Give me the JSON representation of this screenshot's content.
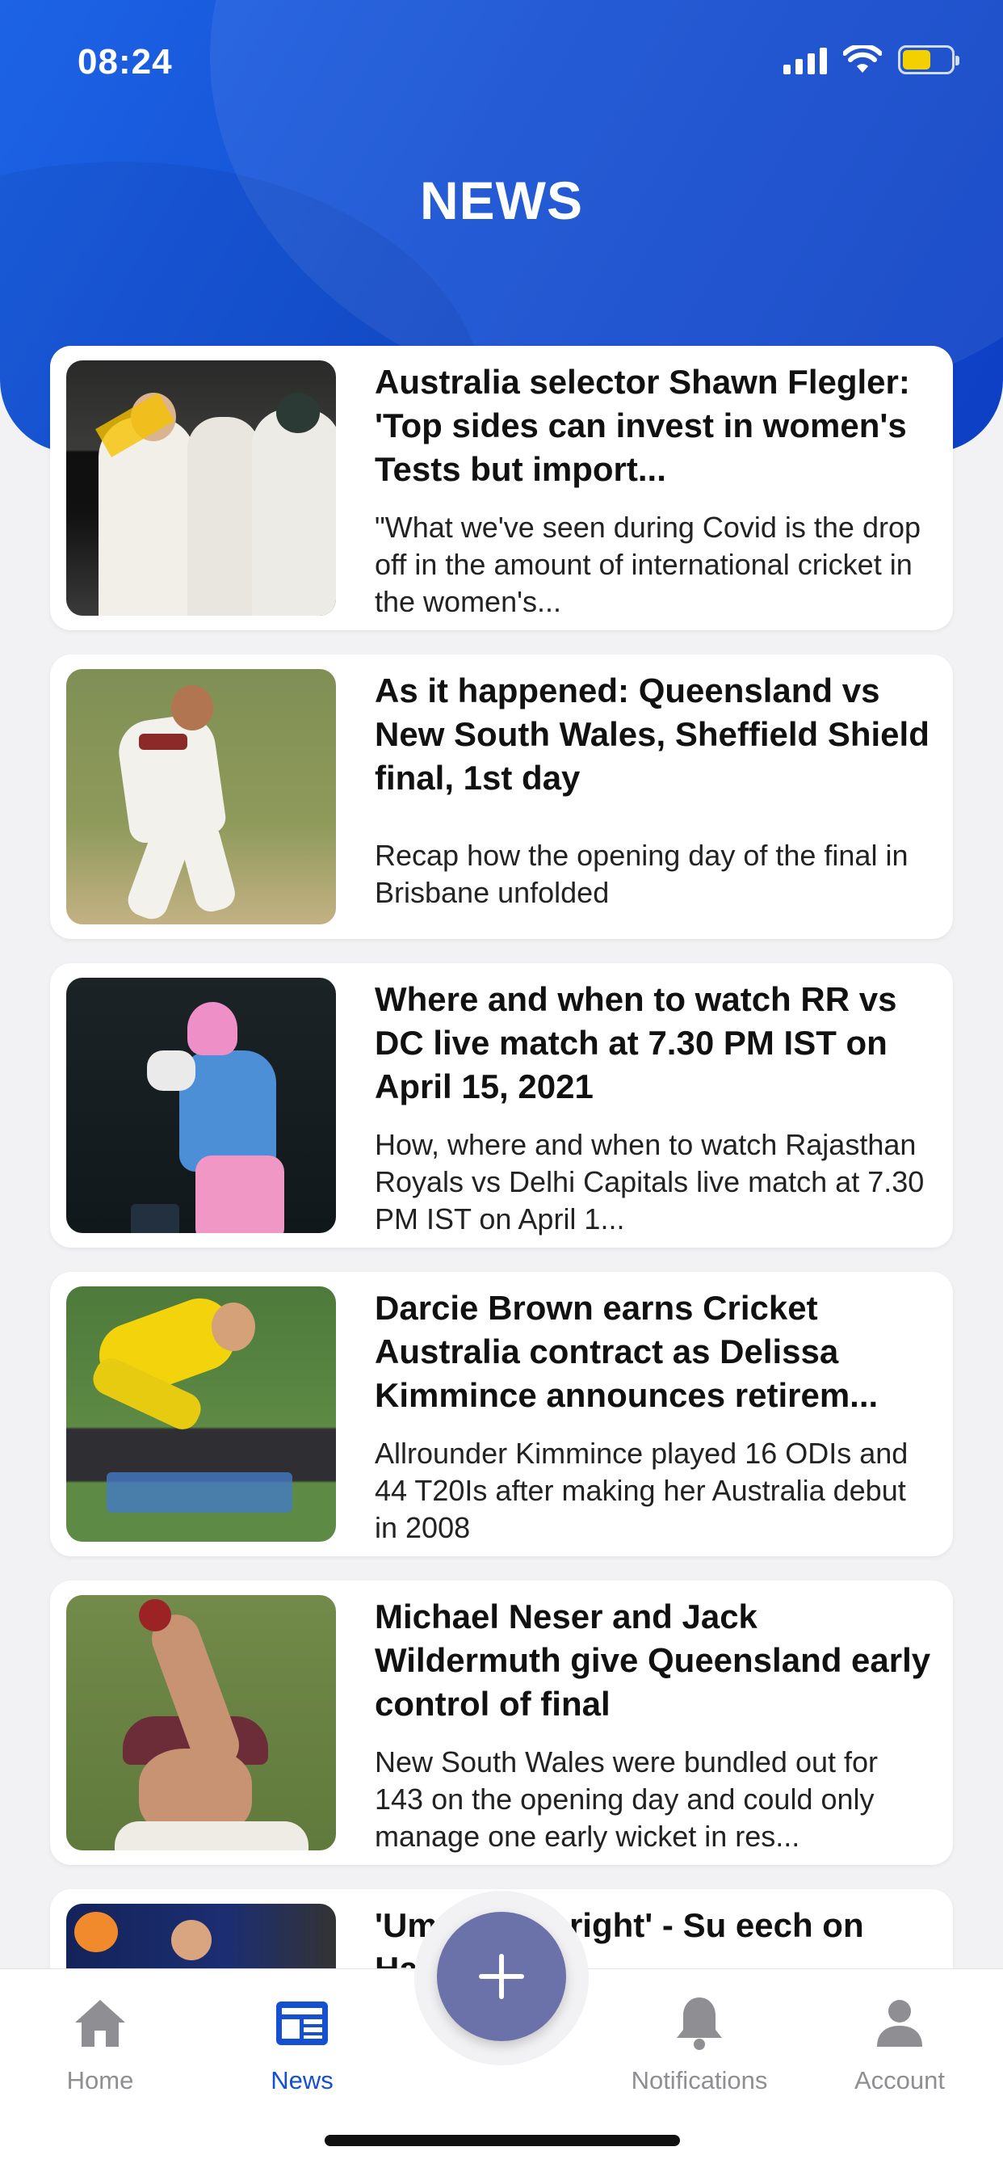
{
  "status_bar": {
    "time": "08:24",
    "icons": [
      "cellular-signal-icon",
      "wifi-icon",
      "battery-charging-icon"
    ],
    "battery_color": "#f5d000"
  },
  "header": {
    "title": "NEWS",
    "background_color": "#1550d2"
  },
  "news": [
    {
      "headline": "Australia selector Shawn Flegler: 'Top sides can invest in women's Tests but import...",
      "summary": "\"What we've seen during Covid is the drop off in the amount of international cricket in the women's..."
    },
    {
      "headline": "As it happened: Queensland vs New South Wales, Sheffield Shield final, 1st day",
      "summary": "Recap how the opening day of the final in Brisbane unfolded"
    },
    {
      "headline": "Where and when to watch RR vs DC live match at 7.30 PM IST on April 15, 2021",
      "summary": "How, where and when to watch Rajasthan Royals vs Delhi Capitals live match at 7.30 PM IST on April 1..."
    },
    {
      "headline": "Darcie Brown earns Cricket Australia contract as Delissa Kimmince announces retirem...",
      "summary": "Allrounder Kimmince played 16 ODIs and 44 T20Is after making her Australia debut in 2008"
    },
    {
      "headline": "Michael Neser and Jack Wildermuth give Queensland early control of final",
      "summary": "New South Wales were bundled out for 143 on the opening day and could only manage one early wicket in res..."
    },
    {
      "headline": "'Umpi  got it right' - Su         eech on Harshal",
      "summary": ""
    }
  ],
  "bottom_nav": {
    "items": [
      {
        "label": "Home",
        "icon": "home-icon"
      },
      {
        "label": "News",
        "icon": "news-icon"
      },
      {
        "label": "Notifications",
        "icon": "bell-icon"
      },
      {
        "label": "Account",
        "icon": "person-icon"
      }
    ],
    "active": "News",
    "active_color": "#1550d2",
    "inactive_color": "#8e8e93",
    "fab_icon": "plus-icon",
    "fab_color": "#6a72a9"
  }
}
